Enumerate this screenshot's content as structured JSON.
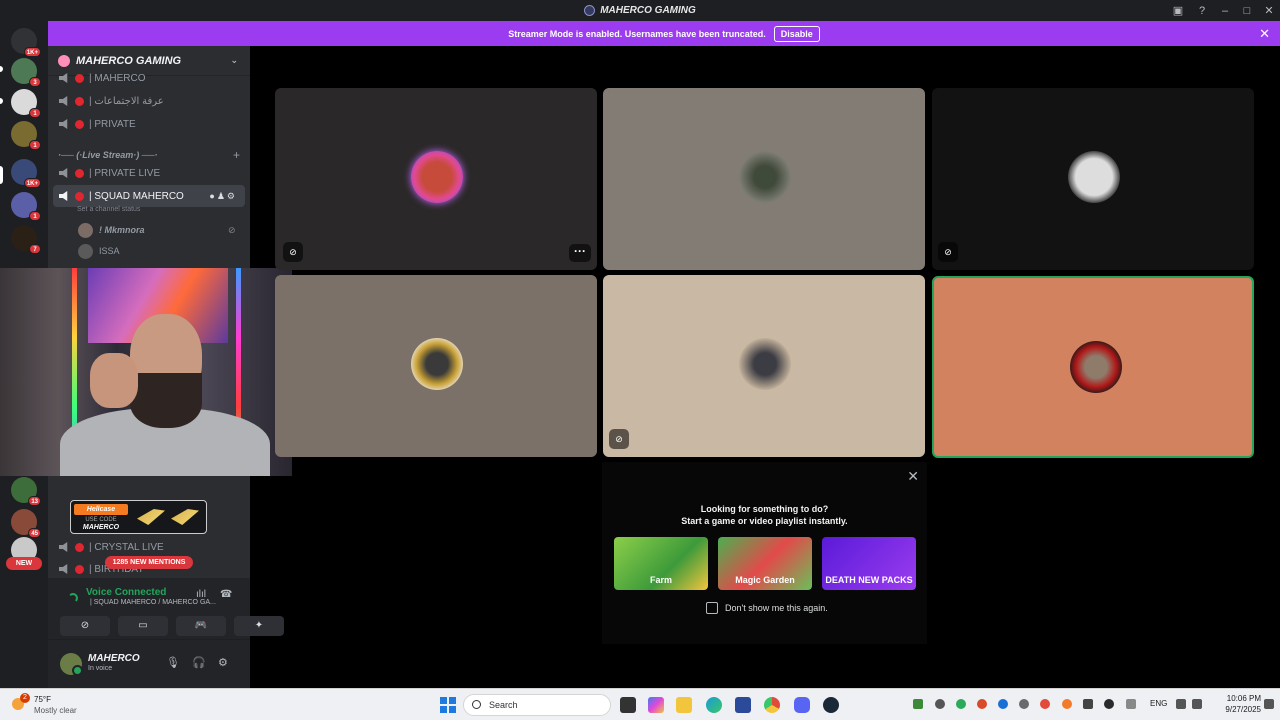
{
  "window": {
    "title": "MAHERCO GAMING"
  },
  "banner": {
    "text": "Streamer Mode is enabled. Usernames have been truncated.",
    "button": "Disable"
  },
  "guild_badges": [
    "1K+",
    "3",
    "1",
    "1",
    "1K+",
    "1",
    "7",
    "13",
    "45"
  ],
  "new_pill": "NEW",
  "server": {
    "name": "MAHERCO GAMING"
  },
  "channels": [
    {
      "name": "| MAHERCO"
    },
    {
      "name": "| عرفة الاجتماعات"
    },
    {
      "name": "| PRIVATE"
    }
  ],
  "category": {
    "name": "·── (·Live Stream·) ──·"
  },
  "live_channels": [
    {
      "name": "| PRIVATE LIVE"
    },
    {
      "name": "| SQUAD MAHERCO"
    }
  ],
  "channel_status_placeholder": "Set a channel status",
  "voice_users": [
    {
      "name": "! Mkmnora"
    },
    {
      "name": "ISSA"
    }
  ],
  "bottom_channels": [
    {
      "name": "| CRYSTAL LIVE"
    },
    {
      "name": "| BIRTHDAY"
    }
  ],
  "hellcase": {
    "logo": "Hellcase",
    "code_label": "USE CODE",
    "code": "MAHERCO"
  },
  "mentions_pill": "1285 NEW MENTIONS",
  "voice_panel": {
    "status": "Voice Connected",
    "path": "| SQUAD MAHERCO / MAHERCO GA..."
  },
  "user": {
    "name": "MAHERCO",
    "status": "In voice"
  },
  "promo": {
    "line1": "Looking for something to do?",
    "line2": "Start a game or video playlist instantly.",
    "cards": [
      "Farm",
      "Magic Garden",
      "DEATH NEW PACKS"
    ],
    "checkbox_label": "Don't show me this again."
  },
  "taskbar": {
    "weather_temp": "75°F",
    "weather_cond": "Mostly clear",
    "weather_badge": "2",
    "search_placeholder": "Search",
    "lang": "ENG",
    "time": "10:06 PM",
    "date": "9/27/2025"
  },
  "colors": {
    "streamer_banner": "#9b3cf0",
    "speaking_border": "#23a55a",
    "mention_red": "#da373c",
    "tile_bg": [
      "#2a2829",
      "#837c74",
      "#121212",
      "#7b7168",
      "#c9b9a4",
      "#d2825e"
    ]
  }
}
